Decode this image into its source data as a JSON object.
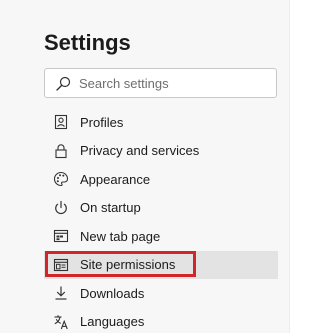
{
  "settings": {
    "title": "Settings",
    "search": {
      "placeholder": "Search settings",
      "value": ""
    },
    "nav": [
      {
        "label": "Profiles",
        "icon": "profile-icon",
        "selected": false
      },
      {
        "label": "Privacy and services",
        "icon": "lock-icon",
        "selected": false
      },
      {
        "label": "Appearance",
        "icon": "palette-icon",
        "selected": false
      },
      {
        "label": "On startup",
        "icon": "power-icon",
        "selected": false
      },
      {
        "label": "New tab page",
        "icon": "new-tab-icon",
        "selected": false
      },
      {
        "label": "Site permissions",
        "icon": "site-permissions-icon",
        "selected": true
      },
      {
        "label": "Downloads",
        "icon": "download-icon",
        "selected": false
      },
      {
        "label": "Languages",
        "icon": "languages-icon",
        "selected": false
      }
    ]
  },
  "colors": {
    "panel_bg": "#f7f7f7",
    "selected_bg": "#e3e3e3",
    "highlight_border": "#d0262a",
    "text": "#1b1b1b"
  }
}
